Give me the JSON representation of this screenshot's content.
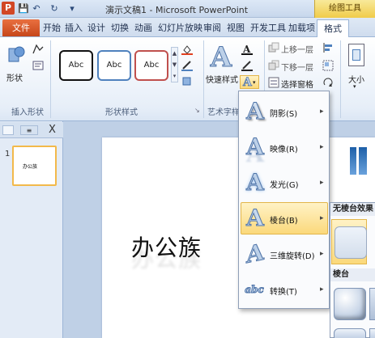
{
  "window": {
    "title": "演示文稿1 - Microsoft PowerPoint",
    "app_icon": "P",
    "context_tab": "绘图工具"
  },
  "quick_access": {
    "save": "save-icon",
    "undo": "undo-icon",
    "redo": "redo-icon",
    "customize": "customize-icon"
  },
  "tabs": {
    "file": "文件",
    "items": [
      "开始",
      "插入",
      "设计",
      "切换",
      "动画",
      "幻灯片放映",
      "审阅",
      "视图",
      "开发工具",
      "加载项"
    ],
    "format": "格式"
  },
  "ribbon": {
    "insert_shapes": {
      "label": "插入形状",
      "shapes_button": "形状"
    },
    "shape_styles": {
      "label": "形状样式",
      "samples": [
        "Abc",
        "Abc",
        "Abc"
      ]
    },
    "wordart": {
      "label": "艺术字样",
      "quick_styles": "快速样式",
      "letter": "A"
    },
    "arrange": {
      "bring_forward": "上移一层",
      "send_backward": "下移一层",
      "selection_pane": "选择窗格"
    },
    "size": {
      "label": "大小"
    }
  },
  "effects_menu": {
    "items": [
      {
        "label": "阴影(S)",
        "glyph": "A"
      },
      {
        "label": "映像(R)",
        "glyph": "A"
      },
      {
        "label": "发光(G)",
        "glyph": "A"
      },
      {
        "label": "棱台(B)",
        "glyph": "A"
      },
      {
        "label": "三维旋转(D)",
        "glyph": "A"
      },
      {
        "label": "转换(T)",
        "glyph": "abc"
      }
    ]
  },
  "bevel_submenu": {
    "no_bevel_heading": "无棱台效果",
    "bevel_heading": "棱台"
  },
  "slide_pane": {
    "slide_number": "1",
    "close": "X"
  },
  "slide": {
    "text": "办公族"
  },
  "colors": {
    "file_tab": "#d24726",
    "selection": "#fbd97b",
    "ribbon": "#e6eef8"
  }
}
